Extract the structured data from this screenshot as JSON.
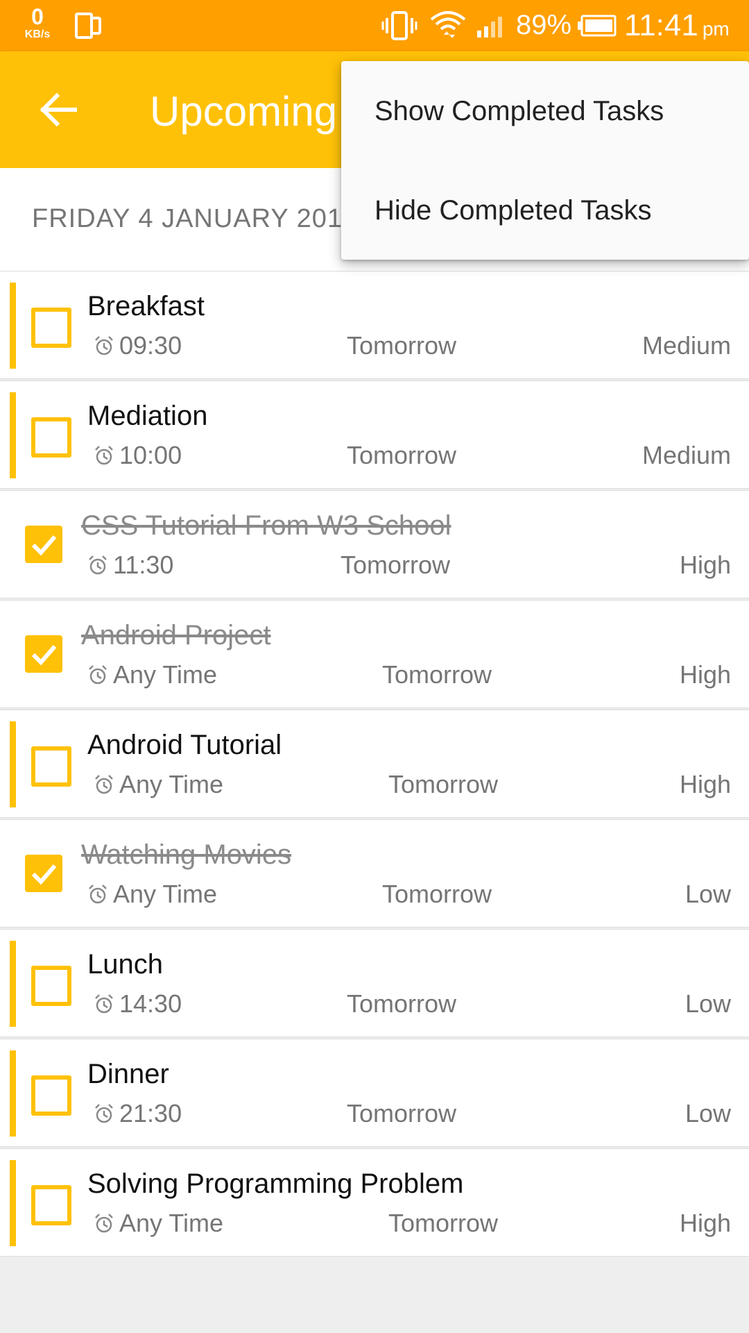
{
  "status_bar": {
    "net_speed_value": "0",
    "net_speed_unit": "KB/s",
    "battery_percent": "89%",
    "time": "11:41",
    "ampm": "pm"
  },
  "app_bar": {
    "title": "Upcoming",
    "back_icon": "arrow-back-icon"
  },
  "date_header": "FRIDAY 4 JANUARY 201",
  "menu": {
    "items": [
      {
        "label": "Show Completed Tasks"
      },
      {
        "label": "Hide Completed Tasks"
      }
    ]
  },
  "tasks": [
    {
      "title": "Breakfast",
      "time": "09:30",
      "day": "Tomorrow",
      "priority": "Medium",
      "completed": false
    },
    {
      "title": "Mediation",
      "time": "10:00",
      "day": "Tomorrow",
      "priority": "Medium",
      "completed": false
    },
    {
      "title": "CSS Tutorial From W3 School",
      "time": "11:30",
      "day": "Tomorrow",
      "priority": "High",
      "completed": true
    },
    {
      "title": "Android Project",
      "time": "Any Time",
      "day": "Tomorrow",
      "priority": "High",
      "completed": true
    },
    {
      "title": "Android Tutorial",
      "time": "Any Time",
      "day": "Tomorrow",
      "priority": "High",
      "completed": false
    },
    {
      "title": "Watching Movies",
      "time": "Any Time",
      "day": "Tomorrow",
      "priority": "Low",
      "completed": true
    },
    {
      "title": "Lunch",
      "time": "14:30",
      "day": "Tomorrow",
      "priority": "Low",
      "completed": false
    },
    {
      "title": "Dinner",
      "time": "21:30",
      "day": "Tomorrow",
      "priority": "Low",
      "completed": false
    },
    {
      "title": "Solving Programming Problem",
      "time": "Any Time",
      "day": "Tomorrow",
      "priority": "High",
      "completed": false
    }
  ],
  "colors": {
    "status_bar": "#ff9f00",
    "app_bar": "#ffc107",
    "accent": "#ffc107"
  }
}
